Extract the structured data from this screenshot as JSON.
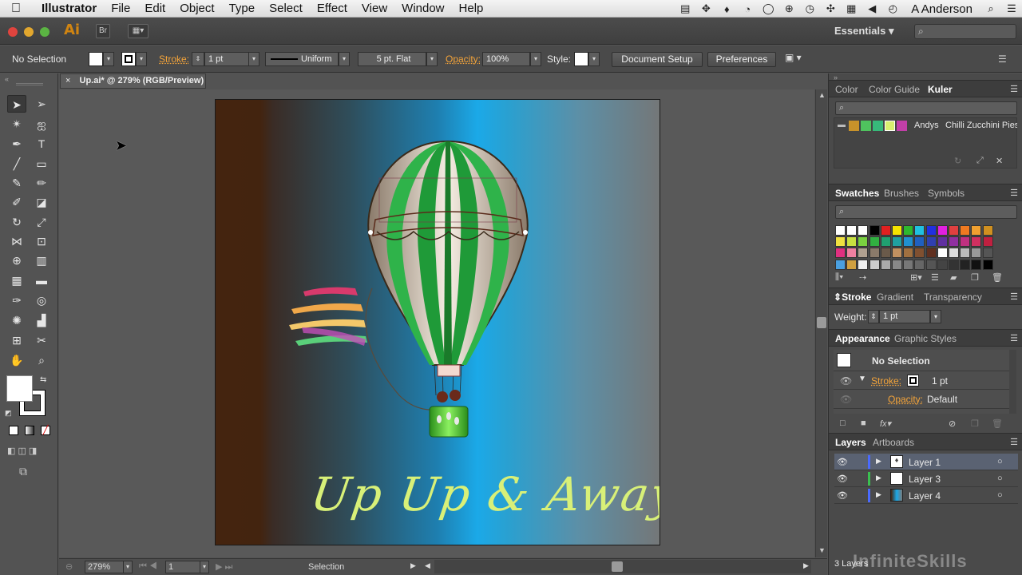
{
  "menubar": {
    "apple": "",
    "app": "Illustrator",
    "items": [
      "File",
      "Edit",
      "Object",
      "Type",
      "Select",
      "Effect",
      "View",
      "Window",
      "Help"
    ],
    "user": "A Anderson"
  },
  "appbar": {
    "logo": "Ai",
    "bridge": "Br",
    "workspace": "Essentials"
  },
  "control": {
    "selection": "No Selection",
    "stroke_label": "Stroke:",
    "stroke_weight": "1 pt",
    "profile": "Uniform",
    "brush": "5 pt. Flat",
    "opacity_label": "Opacity:",
    "opacity": "100%",
    "style_label": "Style:",
    "doc_setup": "Document Setup",
    "preferences": "Preferences"
  },
  "document": {
    "tab": "Up.ai* @ 279% (RGB/Preview)",
    "title_text": "Up Up & Away"
  },
  "status": {
    "zoom": "279%",
    "artboard": "1",
    "tool": "Selection"
  },
  "panels": {
    "color_tabs": [
      "Color",
      "Color Guide",
      "Kuler"
    ],
    "kuler_owner": "Andys",
    "kuler_theme": "Chilli Zucchini Pies",
    "swatch_tabs": [
      "Swatches",
      "Brushes",
      "Symbols"
    ],
    "stroke_tabs": [
      "Stroke",
      "Gradient",
      "Transparency"
    ],
    "weight_label": "Weight:",
    "weight_value": "1 pt",
    "appearance_tabs": [
      "Appearance",
      "Graphic Styles"
    ],
    "appearance_selection": "No Selection",
    "appearance_stroke_label": "Stroke:",
    "appearance_stroke_value": "1 pt",
    "appearance_opacity_label": "Opacity:",
    "appearance_opacity_value": "Default",
    "layers_tabs": [
      "Layers",
      "Artboards"
    ],
    "layers": [
      "Layer 1",
      "Layer 3",
      "Layer 4"
    ],
    "layer_count": "3 Layers"
  },
  "watermark": "InfiniteSkills",
  "colors": {
    "accent_orange": "#f4a43a",
    "title_yellow": "#d8f078",
    "balloon_green": "#2fb34a"
  }
}
